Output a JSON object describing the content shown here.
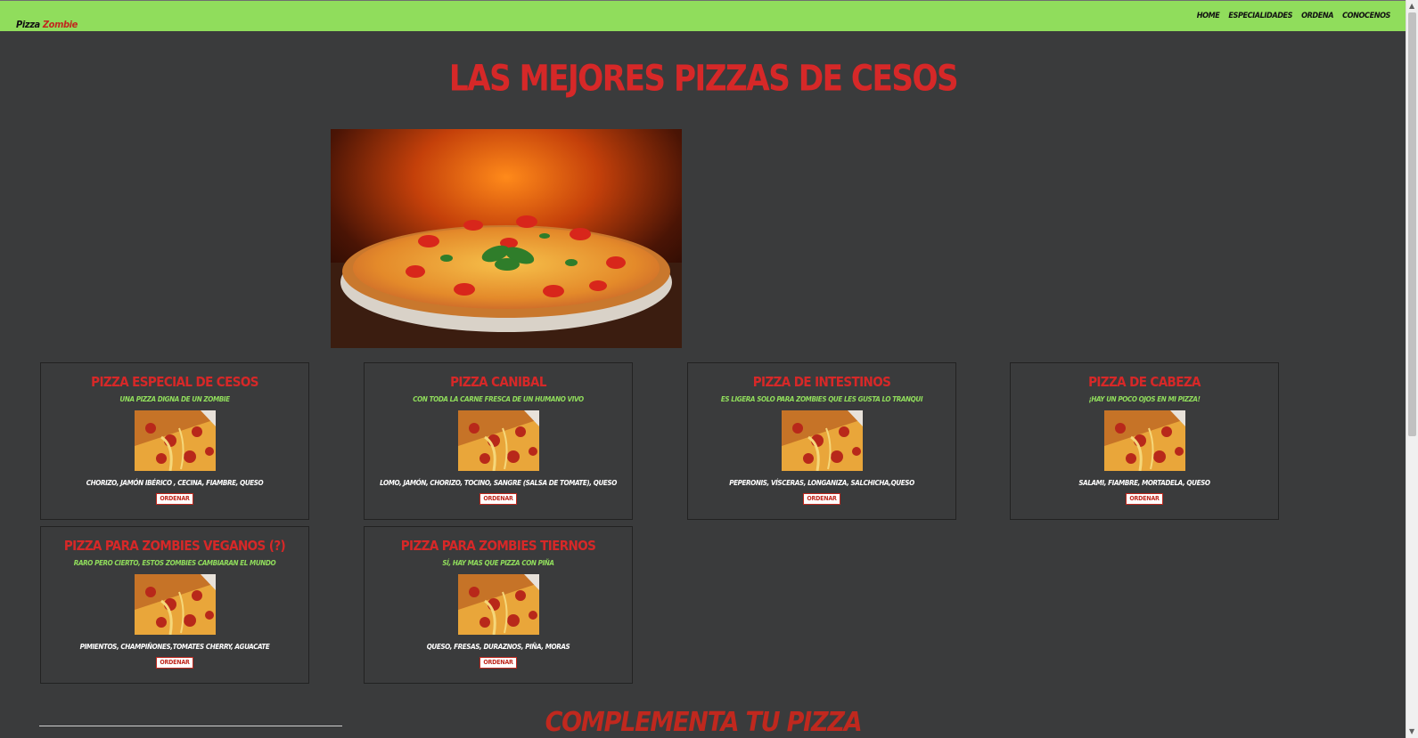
{
  "navbar": {
    "brand_part1": "Pizza",
    "brand_part2": "Zombie",
    "links": [
      "Home",
      "Especialidades",
      "Ordena",
      "Conocenos"
    ]
  },
  "hero": {
    "title": "Las mejores pizzas de cesos"
  },
  "cards": [
    {
      "title": "Pizza especial de cesos",
      "subtitle": "Una pizza digna de un zombie",
      "ingredients": "Chorizo, Jamón Ibérico , Cecina, Fiambre, Queso",
      "button": "Ordenar"
    },
    {
      "title": "Pizza Canibal",
      "subtitle": "Con toda la carne fresca de un humano vivo",
      "ingredients": "Lomo, Jamón, Chorizo, Tocino, Sangre (salsa de tomate), Queso",
      "button": "Ordenar"
    },
    {
      "title": "Pizza de intestinos",
      "subtitle": "Es ligera solo para zombies que les gusta lo tranqui",
      "ingredients": "Peperonis, Vísceras, Longaniza, Salchicha,Queso",
      "button": "Ordenar"
    },
    {
      "title": "Pizza de cabeza",
      "subtitle": "¡Hay un poco ojos en mi pizza!",
      "ingredients": "Salami, Fiambre, Mortadela, Queso",
      "button": "Ordenar"
    },
    {
      "title": "Pizza para zombies veganos (?)",
      "subtitle": "Raro pero cierto, estos zombies cambiaran el mundo",
      "ingredients": "Pimientos, Champiñones,Tomates Cherry, Aguacate",
      "button": "Ordenar"
    },
    {
      "title": "Pizza para zombies tiernos",
      "subtitle": "Sí, hay mas que pizza con piña",
      "ingredients": "Queso, Fresas, Duraznos, Piña, Moras",
      "button": "Ordenar"
    }
  ],
  "section": {
    "title": "Complementa tu pizza"
  },
  "colors": {
    "navbar": "#90dd5c",
    "background": "#3a3b3c",
    "accent_red": "#d62828",
    "subtitle_green": "#90dd5c"
  }
}
